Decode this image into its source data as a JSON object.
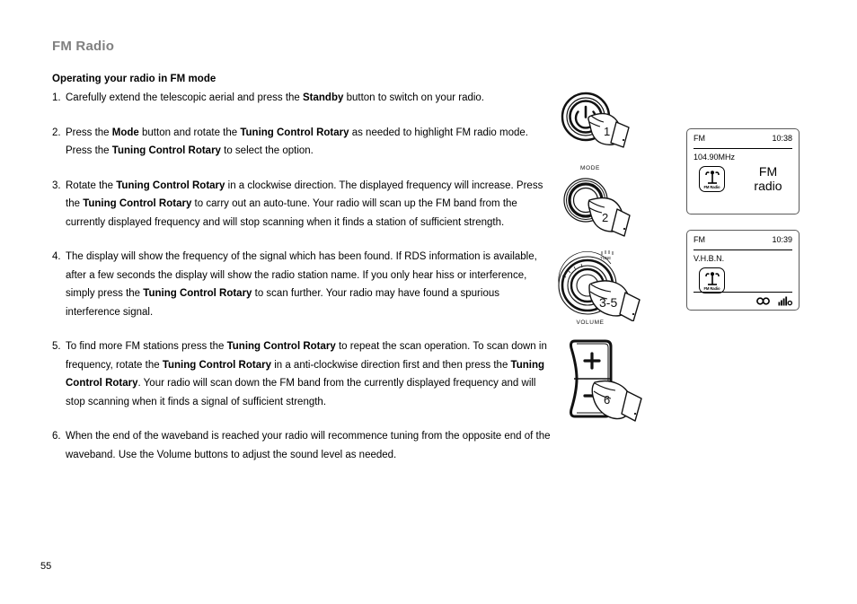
{
  "page": {
    "title": "FM Radio",
    "number": "55"
  },
  "section": {
    "heading": "Operating your radio in FM mode"
  },
  "steps": [
    {
      "num": "1.",
      "parts": [
        {
          "t": "Carefully extend the telescopic aerial and press the ",
          "b": false
        },
        {
          "t": "Standby",
          "b": true
        },
        {
          "t": " button to switch on your radio.",
          "b": false
        }
      ]
    },
    {
      "num": "2.",
      "parts": [
        {
          "t": "Press the ",
          "b": false
        },
        {
          "t": "Mode",
          "b": true
        },
        {
          "t": " button and rotate the ",
          "b": false
        },
        {
          "t": "Tuning Control Rotary",
          "b": true
        },
        {
          "t": " as needed to highlight FM radio mode. Press the ",
          "b": false
        },
        {
          "t": "Tuning Control Rotary",
          "b": true
        },
        {
          "t": " to select the option.",
          "b": false
        }
      ]
    },
    {
      "num": "3.",
      "parts": [
        {
          "t": "Rotate the ",
          "b": false
        },
        {
          "t": "Tuning Control Rotary",
          "b": true
        },
        {
          "t": " in a clockwise direction. The displayed frequency will increase. Press the ",
          "b": false
        },
        {
          "t": "Tuning Control Rotary",
          "b": true
        },
        {
          "t": " to carry out an auto-tune. Your radio will scan up the FM band from the currently displayed frequency and will stop scanning when it finds a station of sufficient strength.",
          "b": false
        }
      ]
    },
    {
      "num": "4.",
      "parts": [
        {
          "t": "The display will show the frequency of the signal which has been found. If RDS information is available, after a few seconds the display will show the radio station name. If you only hear hiss or interference, simply press the ",
          "b": false
        },
        {
          "t": "Tuning Control Rotary",
          "b": true
        },
        {
          "t": " to scan further. Your radio may have found a spurious interference signal.",
          "b": false
        }
      ]
    },
    {
      "num": "5.",
      "parts": [
        {
          "t": "To find more FM stations press the ",
          "b": false
        },
        {
          "t": "Tuning Control Rotary",
          "b": true
        },
        {
          "t": " to repeat the scan operation. To scan down in frequency, rotate the ",
          "b": false
        },
        {
          "t": "Tuning Control Rotary",
          "b": true
        },
        {
          "t": " in a anti-clockwise direction first and then press the ",
          "b": false
        },
        {
          "t": "Tuning Control Rotary",
          "b": true
        },
        {
          "t": ". Your radio will scan down the FM band from the currently displayed frequency and will stop scanning when it finds a signal of sufficient strength.",
          "b": false
        }
      ]
    },
    {
      "num": "6.",
      "parts": [
        {
          "t": "When the end of the waveband is reached your radio will recommence tuning from the opposite end of the waveband. Use the Volume buttons to adjust the sound level as needed.",
          "b": false
        }
      ]
    }
  ],
  "illustrations": [
    {
      "id": "standby-button",
      "step_number": "1",
      "control_label": "",
      "icon": "power-icon"
    },
    {
      "id": "mode-button",
      "step_number": "2",
      "control_label": "MODE",
      "icon": "round-button-icon"
    },
    {
      "id": "tuning-control-rotary",
      "step_number": "3-5",
      "control_label": "VOLUME",
      "tuner_label": "TUNE",
      "icon": "rotary-dial-icon"
    },
    {
      "id": "volume-buttons",
      "step_number": "6",
      "plus_label": "+",
      "minus_label": "−",
      "icon": "volume-rocker-icon"
    }
  ],
  "displays": [
    {
      "id": "display-frequency",
      "band": "FM",
      "time": "10:38",
      "line1": "104.90MHz",
      "mode_icon_label": "FM Radio",
      "big_text_line1": "FM",
      "big_text_line2": "radio",
      "footer_icons": []
    },
    {
      "id": "display-station-name",
      "band": "FM",
      "time": "10:39",
      "line1": "V.H.B.N.",
      "mode_icon_label": "FM Radio",
      "big_text_line1": "",
      "big_text_line2": "",
      "footer_icons": [
        "stereo-icon",
        "signal-strength-icon"
      ]
    }
  ],
  "colors": {
    "title": "#808080",
    "text": "#000000",
    "lcd_border": "#5a5a5a",
    "background": "#ffffff"
  }
}
